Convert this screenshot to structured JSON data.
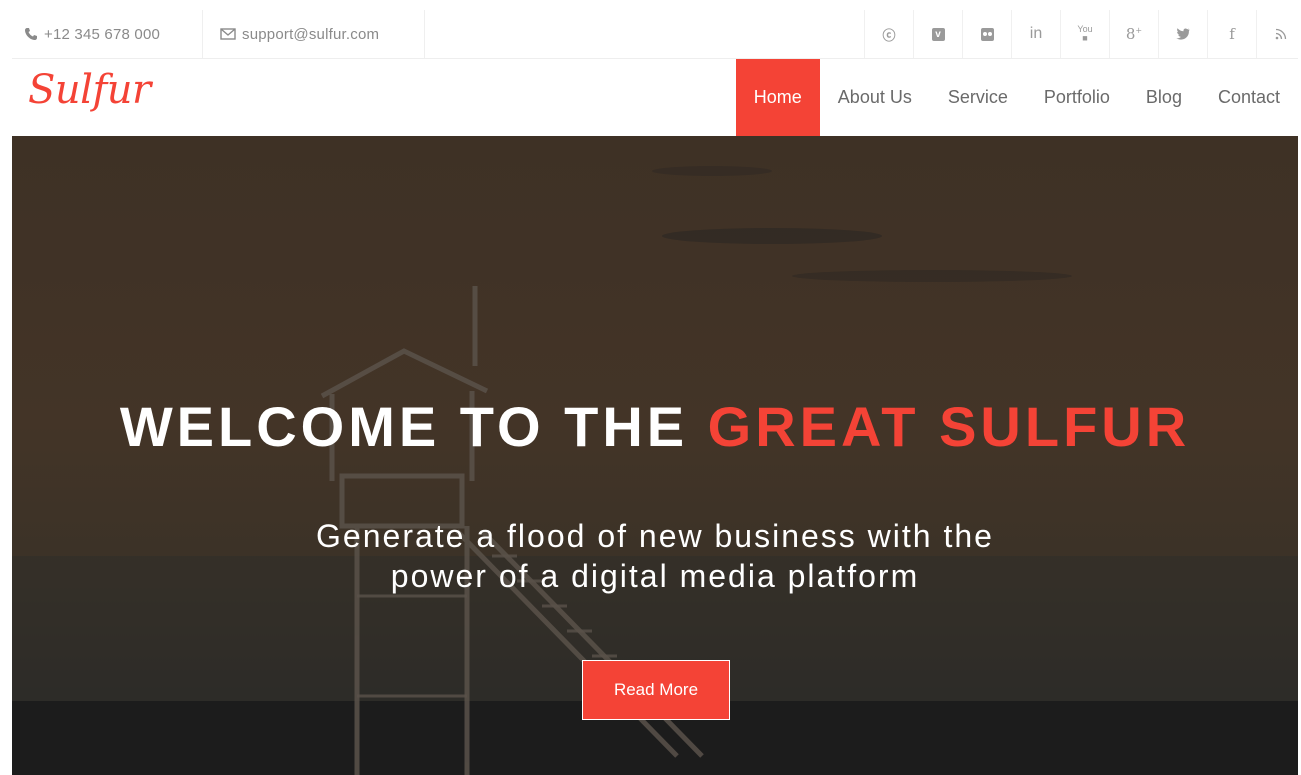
{
  "topbar": {
    "phone": "+12 345 678 000",
    "email": "support@sulfur.com",
    "socials": [
      {
        "icon": "skype-icon",
        "glyph": "S"
      },
      {
        "icon": "vimeo-icon",
        "glyph": "v"
      },
      {
        "icon": "flickr-icon",
        "glyph": "••"
      },
      {
        "icon": "linkedin-icon",
        "glyph": "in"
      },
      {
        "icon": "youtube-icon",
        "glyph": "You"
      },
      {
        "icon": "google-plus-icon",
        "glyph": "g+"
      },
      {
        "icon": "twitter-icon",
        "glyph": "t"
      },
      {
        "icon": "facebook-icon",
        "glyph": "f"
      },
      {
        "icon": "rss-icon",
        "glyph": "rss"
      }
    ]
  },
  "header": {
    "logo": "Sulfur",
    "nav": [
      "Home",
      "About Us",
      "Service",
      "Portfolio",
      "Blog",
      "Contact"
    ],
    "active": "Home"
  },
  "hero": {
    "title_main": "WELCOME TO THE ",
    "title_accent": "GREAT SULFUR",
    "subtitle_line1": "Generate a flood of new business with the",
    "subtitle_line2": "power of a digital media platform",
    "button_label": "Read More"
  },
  "colors": {
    "accent": "#f44336",
    "text_muted": "#8a8a8a",
    "hero_overlay": "#3e3125"
  }
}
